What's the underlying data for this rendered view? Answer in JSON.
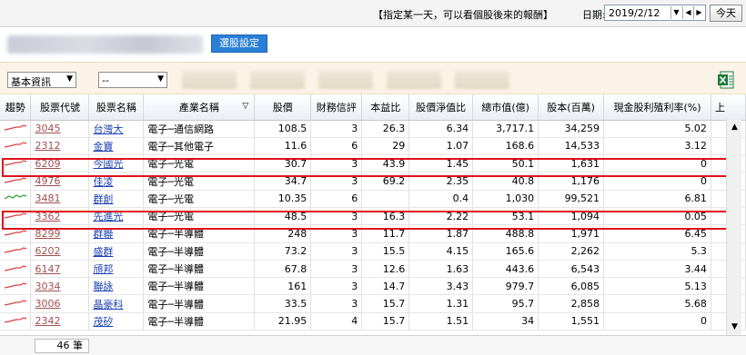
{
  "topbar": {
    "hint": "【指定某一天，可以看個股後來的報酬】",
    "date_label": "日期:",
    "date_value": "2019/2/12",
    "today_label": "今天"
  },
  "title": {
    "select_button": "選股設定"
  },
  "filters": {
    "category_value": "基本資訊",
    "second_value": "--"
  },
  "table": {
    "headers": [
      "趨勢",
      "股票代號",
      "股票名稱",
      "產業名稱",
      "股價",
      "財務信評",
      "本益比",
      "股價淨值比",
      "總市值(億)",
      "股本(百萬)",
      "現金股利殖利率(%)",
      "上"
    ],
    "rows": [
      {
        "code": "3045",
        "name": "台灣大",
        "industry": "電子─通信網路",
        "price": "108.5",
        "rating": "3",
        "pe": "26.3",
        "pb": "6.34",
        "mcap": "3,717.1",
        "capital": "34,259",
        "yield": "5.02",
        "trend": "red"
      },
      {
        "code": "2312",
        "name": "金寶",
        "industry": "電子─其他電子",
        "price": "11.6",
        "rating": "6",
        "pe": "29",
        "pb": "1.07",
        "mcap": "168.6",
        "capital": "14,533",
        "yield": "3.12",
        "trend": "red"
      },
      {
        "code": "6209",
        "name": "今國光",
        "industry": "電子─光電",
        "price": "30.7",
        "rating": "3",
        "pe": "43.9",
        "pb": "1.45",
        "mcap": "50.1",
        "capital": "1,631",
        "yield": "0",
        "trend": "red"
      },
      {
        "code": "4976",
        "name": "佳凌",
        "industry": "電子─光電",
        "price": "34.7",
        "rating": "3",
        "pe": "69.2",
        "pb": "2.35",
        "mcap": "40.8",
        "capital": "1,176",
        "yield": "0",
        "trend": "red"
      },
      {
        "code": "3481",
        "name": "群創",
        "industry": "電子─光電",
        "price": "10.35",
        "rating": "6",
        "pe": "",
        "pb": "0.4",
        "mcap": "1,030",
        "capital": "99,521",
        "yield": "6.81",
        "trend": "green"
      },
      {
        "code": "3362",
        "name": "先進光",
        "industry": "電子─光電",
        "price": "48.5",
        "rating": "3",
        "pe": "16.3",
        "pb": "2.22",
        "mcap": "53.1",
        "capital": "1,094",
        "yield": "0.05",
        "trend": "red"
      },
      {
        "code": "8299",
        "name": "群聯",
        "industry": "電子─半導體",
        "price": "248",
        "rating": "3",
        "pe": "11.7",
        "pb": "1.87",
        "mcap": "488.8",
        "capital": "1,971",
        "yield": "6.45",
        "trend": "red"
      },
      {
        "code": "6202",
        "name": "盛群",
        "industry": "電子─半導體",
        "price": "73.2",
        "rating": "3",
        "pe": "15.5",
        "pb": "4.15",
        "mcap": "165.6",
        "capital": "2,262",
        "yield": "5.3",
        "trend": "red"
      },
      {
        "code": "6147",
        "name": "頎邦",
        "industry": "電子─半導體",
        "price": "67.8",
        "rating": "3",
        "pe": "12.6",
        "pb": "1.63",
        "mcap": "443.6",
        "capital": "6,543",
        "yield": "3.44",
        "trend": "red"
      },
      {
        "code": "3034",
        "name": "聯詠",
        "industry": "電子─半導體",
        "price": "161",
        "rating": "3",
        "pe": "14.7",
        "pb": "3.43",
        "mcap": "979.7",
        "capital": "6,085",
        "yield": "5.13",
        "trend": "red"
      },
      {
        "code": "3006",
        "name": "晶豪科",
        "industry": "電子─半導體",
        "price": "33.5",
        "rating": "3",
        "pe": "15.7",
        "pb": "1.31",
        "mcap": "95.7",
        "capital": "2,858",
        "yield": "5.68",
        "trend": "red"
      },
      {
        "code": "2342",
        "name": "茂矽",
        "industry": "電子─半導體",
        "price": "21.95",
        "rating": "4",
        "pe": "15.7",
        "pb": "1.51",
        "mcap": "34",
        "capital": "1,551",
        "yield": "0",
        "trend": "red"
      }
    ]
  },
  "footer": {
    "count": "46 筆"
  },
  "colors": {
    "accent": "#2a7fd6",
    "highlight": "#e0101c",
    "trend_red": "#d94040",
    "trend_green": "#2aa02a"
  }
}
